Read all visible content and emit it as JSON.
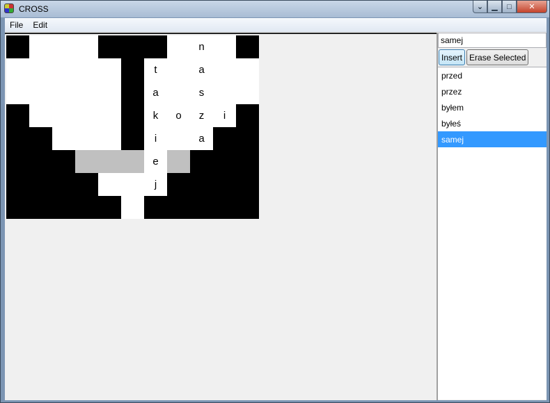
{
  "window": {
    "title": "CROSS"
  },
  "menu": {
    "file": "File",
    "edit": "Edit"
  },
  "grid": {
    "rows": [
      [
        "b",
        "w",
        "w",
        "w",
        "b",
        "b",
        "b",
        "w",
        "w",
        "w",
        "b"
      ],
      [
        "w",
        "w",
        "w",
        "w",
        "w",
        "b",
        "w",
        "w",
        "w",
        "w",
        "w"
      ],
      [
        "w",
        "w",
        "w",
        "w",
        "w",
        "b",
        "w",
        "w",
        "w",
        "w",
        "w"
      ],
      [
        "b",
        "w",
        "w",
        "w",
        "w",
        "b",
        "w",
        "w",
        "w",
        "w",
        "b"
      ],
      [
        "b",
        "b",
        "w",
        "w",
        "w",
        "b",
        "w",
        "w",
        "w",
        "b",
        "b"
      ],
      [
        "b",
        "b",
        "b",
        "g",
        "g",
        "g",
        "w",
        "g",
        "b",
        "b",
        "b"
      ],
      [
        "b",
        "b",
        "b",
        "b",
        "w",
        "w",
        "w",
        "b",
        "b",
        "b",
        "b"
      ],
      [
        "b",
        "b",
        "b",
        "b",
        "b",
        "w",
        "b",
        "b",
        "b",
        "b",
        "b"
      ]
    ],
    "letters": [
      [
        "",
        "",
        "",
        "",
        "",
        "",
        "",
        "",
        "n",
        "",
        ""
      ],
      [
        "",
        "",
        "",
        "",
        "",
        "",
        "t",
        "",
        "a",
        "",
        ""
      ],
      [
        "",
        "",
        "",
        "",
        "",
        "",
        "a",
        "",
        "s",
        "",
        ""
      ],
      [
        "",
        "",
        "",
        "",
        "",
        "",
        "k",
        "o",
        "z",
        "i",
        ""
      ],
      [
        "",
        "",
        "",
        "",
        "",
        "",
        "i",
        "",
        "a",
        "",
        ""
      ],
      [
        "",
        "",
        "",
        "",
        "",
        "",
        "e",
        "",
        "",
        "",
        ""
      ],
      [
        "",
        "",
        "",
        "",
        "",
        "",
        "j",
        "",
        "",
        "",
        ""
      ],
      [
        "",
        "",
        "",
        "",
        "",
        "",
        "",
        "",
        "",
        "",
        ""
      ]
    ]
  },
  "panel": {
    "input_value": "samej",
    "insert_label": "Insert",
    "erase_label": "Erase Selected",
    "words": [
      "przed",
      "przez",
      "byłem",
      "byłeś",
      "samej"
    ],
    "selected_index": 4
  }
}
